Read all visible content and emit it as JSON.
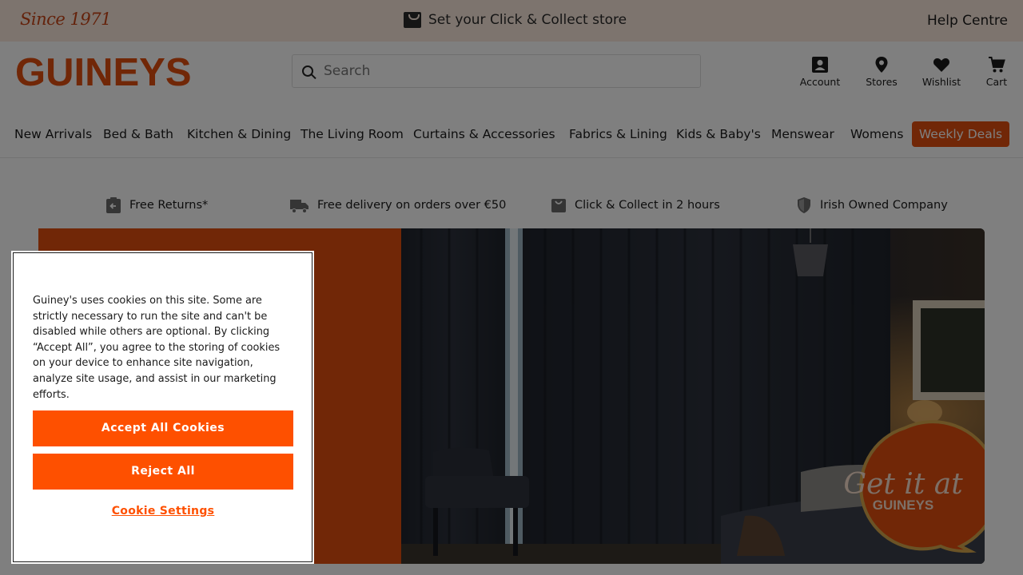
{
  "topbar": {
    "since": "Since 1971",
    "collect": "Set your Click & Collect store",
    "help": "Help Centre"
  },
  "header": {
    "logo": "GUINEYS",
    "search_placeholder": "Search",
    "icons": {
      "account": "Account",
      "stores": "Stores",
      "wishlist": "Wishlist",
      "cart": "Cart"
    }
  },
  "nav": {
    "items": [
      "New Arrivals",
      "Bed & Bath",
      "Kitchen & Dining",
      "The Living Room",
      "Curtains & Accessories",
      "Fabrics & Lining",
      "Kids & Baby's",
      "Menswear",
      "Womens"
    ],
    "deals": "Weekly Deals"
  },
  "usps": [
    "Free Returns*",
    "Free delivery on orders over €50",
    "Click & Collect in 2 hours",
    "Irish Owned Company"
  ],
  "hero": {
    "badge_line1": "Get it at",
    "badge_line2": "GUINEYS"
  },
  "cookie": {
    "text": "Guiney's uses cookies on this site. Some are strictly necessary to run the site and can't be disabled while others are optional. By clicking “Accept All”, you agree to the storing of cookies on your device to enhance site navigation, analyze site usage, and assist in our marketing efforts.",
    "accept": "Accept All Cookies",
    "reject": "Reject All",
    "settings": "Cookie Settings"
  },
  "colors": {
    "brand": "#e24e0f",
    "cookie_button": "#fe5000",
    "topbar_bg": "#fbe9dc"
  }
}
